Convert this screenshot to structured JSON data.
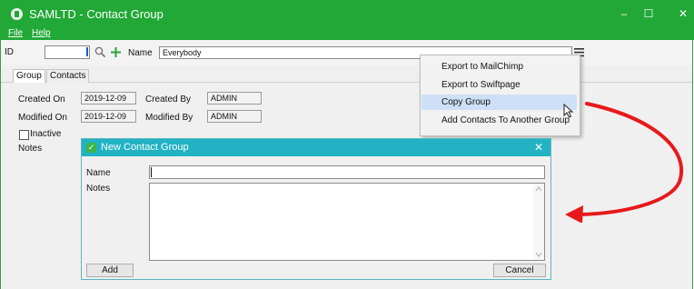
{
  "window": {
    "title": "SAMLTD - Contact Group",
    "controls": {
      "minimize": "–",
      "maximize": "☐",
      "close": "✕"
    }
  },
  "menubar": {
    "file": "File",
    "help": "Help"
  },
  "toolbar": {
    "id_label": "ID",
    "id_value": "",
    "name_label": "Name",
    "name_value": "Everybody",
    "search_icon": "magnifier-icon",
    "add_icon": "plus-icon",
    "menu_icon": "hamburger-icon"
  },
  "tabs": [
    {
      "label": "Group"
    },
    {
      "label": "Contacts"
    }
  ],
  "form": {
    "created_on_label": "Created On",
    "created_on_value": "2019-12-09",
    "created_by_label": "Created By",
    "created_by_value": "ADMIN",
    "modified_on_label": "Modified On",
    "modified_on_value": "2019-12-09",
    "modified_by_label": "Modified By",
    "modified_by_value": "ADMIN",
    "inactive_label": "Inactive",
    "notes_label": "Notes"
  },
  "context_menu": {
    "items": [
      {
        "label": "Export to MailChimp"
      },
      {
        "label": "Export to Swiftpage"
      },
      {
        "label": "Copy Group"
      },
      {
        "label": "Add Contacts To Another Group"
      }
    ],
    "highlighted_index": 2
  },
  "dialog": {
    "title": "New Contact Group",
    "close": "✕",
    "name_label": "Name",
    "name_value": "",
    "notes_label": "Notes",
    "notes_value": "",
    "add_button": "Add",
    "cancel_button": "Cancel"
  },
  "colors": {
    "title_bar": "#21a836",
    "dialog_title_bar": "#21b3c4",
    "menu_highlight": "#cde0f7",
    "annotation_arrow": "#e8191a"
  }
}
